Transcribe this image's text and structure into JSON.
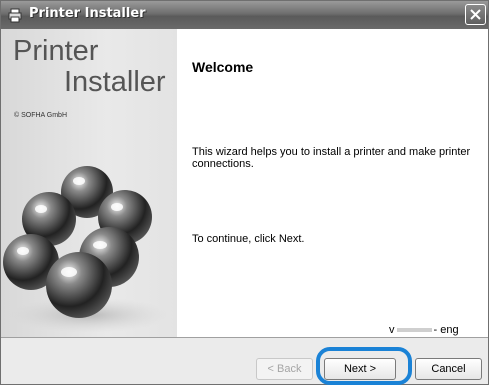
{
  "window": {
    "title": "Printer Installer"
  },
  "sidebar": {
    "logo_line1": "Printer",
    "logo_line2": "Installer",
    "copyright": "© SOFHA GmbH"
  },
  "content": {
    "heading": "Welcome",
    "intro": "This wizard helps you to install a printer and make printer connections.",
    "continue": "To continue, click Next.",
    "version_prefix": "v",
    "version_suffix": "- eng"
  },
  "buttons": {
    "back": "< Back",
    "next": "Next >",
    "cancel": "Cancel"
  },
  "colors": {
    "highlight": "#1a82d6",
    "titlebar": "#6e6e6e"
  },
  "icons": [
    "printer-icon",
    "close-icon",
    "glass-spheres-image"
  ]
}
